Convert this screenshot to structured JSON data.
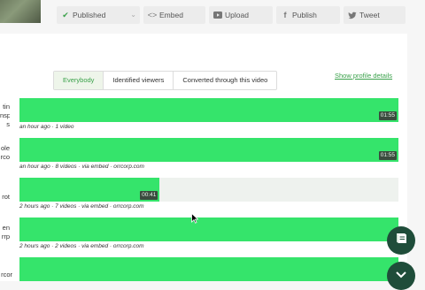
{
  "toolbar": {
    "published_label": "Published",
    "embed_label": "Embed",
    "upload_label": "Upload",
    "publish_label": "Publish",
    "tweet_label": "Tweet"
  },
  "tabs": [
    "Everybody",
    "Identified viewers",
    "Converted through this video"
  ],
  "show_profile_details": "Show profile details",
  "viewers": [
    {
      "name_lines": [
        "tin",
        "nsp",
        "s"
      ],
      "meta": "an hour ago · 1 video",
      "progress": 1.0,
      "duration": "01:55"
    },
    {
      "name_lines": [
        "ole",
        "rco"
      ],
      "meta": "an hour ago · 8 videos · via embed · orrcorp.com",
      "progress": 1.0,
      "duration": "01:55"
    },
    {
      "name_lines": [
        "rot"
      ],
      "meta": "2 hours ago · 7 videos · via embed · orrcorp.com",
      "progress": 0.37,
      "duration": "00:41"
    },
    {
      "name_lines": [
        "en",
        "rrp"
      ],
      "meta": "2 hours ago · 2 videos · via embed · orrcorp.com",
      "progress": 1.0,
      "duration": ""
    },
    {
      "name_lines": [
        "rcor"
      ],
      "meta": "",
      "progress": 1.0,
      "duration": ""
    }
  ],
  "colors": {
    "progress": "#35e46b",
    "accent": "#3aa14a",
    "fab": "#1f4d3a"
  },
  "icons": {
    "published": "check-icon",
    "embed": "code-icon",
    "upload": "upload-icon",
    "publish": "facebook-icon",
    "tweet": "twitter-icon",
    "fab_top": "book-icon",
    "fab_bottom": "chevron-down-icon"
  }
}
